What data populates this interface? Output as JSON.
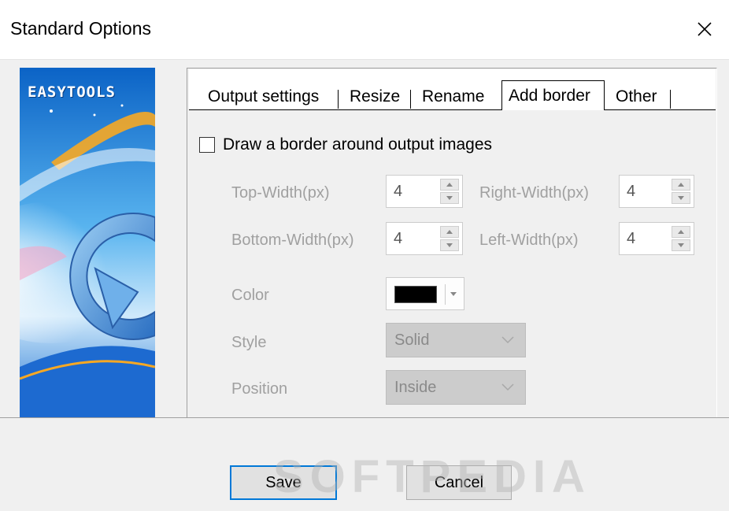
{
  "window": {
    "title": "Standard Options"
  },
  "banner": {
    "brand": "EASYTOOLS"
  },
  "tabs": [
    {
      "label": "Output settings",
      "active": false
    },
    {
      "label": "Resize",
      "active": false
    },
    {
      "label": "Rename",
      "active": false
    },
    {
      "label": "Add border",
      "active": true
    },
    {
      "label": "Other",
      "active": false
    }
  ],
  "border": {
    "checkbox_label": "Draw a border around output images",
    "checked": false,
    "top_label": "Top-Width(px)",
    "top_value": "4",
    "right_label": "Right-Width(px)",
    "right_value": "4",
    "bottom_label": "Bottom-Width(px)",
    "bottom_value": "4",
    "left_label": "Left-Width(px)",
    "left_value": "4",
    "color_label": "Color",
    "color_value": "#000000",
    "style_label": "Style",
    "style_value": "Solid",
    "position_label": "Position",
    "position_value": "Inside"
  },
  "footer": {
    "save_label": "Save",
    "cancel_label": "Cancel"
  },
  "watermark": "SOFTPEDIA"
}
